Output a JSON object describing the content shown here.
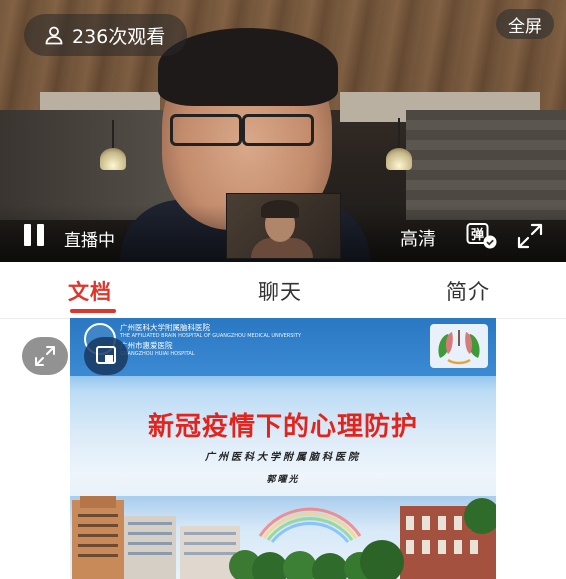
{
  "video": {
    "viewer_count": "236次观看",
    "fullscreen_label": "全屏",
    "live_status": "直播中",
    "quality_label": "高清",
    "icons": [
      "user-icon",
      "pause-icon",
      "danmaku-icon",
      "expand-icon"
    ]
  },
  "tabs": [
    {
      "label": "文档",
      "active": true
    },
    {
      "label": "聊天",
      "active": false
    },
    {
      "label": "简介",
      "active": false
    }
  ],
  "colors": {
    "accent": "#e0352b",
    "slide_title": "#e3241c",
    "slide_header": "#2b78c2"
  },
  "slide": {
    "org_name_cn": "广州医科大学附属脑科医院",
    "org_name_en": "THE AFFILIATED BRAIN HOSPITAL OF GUANGZHOU MEDICAL UNIVERSITY",
    "org_name_cn2": "广州市惠爱医院",
    "org_name_en2": "GUANGZHOU HUIAI HOSPITAL",
    "title": "新冠疫情下的心理防护",
    "subtitle": "广州医科大学附属脑科医院",
    "author": "郭曜光"
  }
}
